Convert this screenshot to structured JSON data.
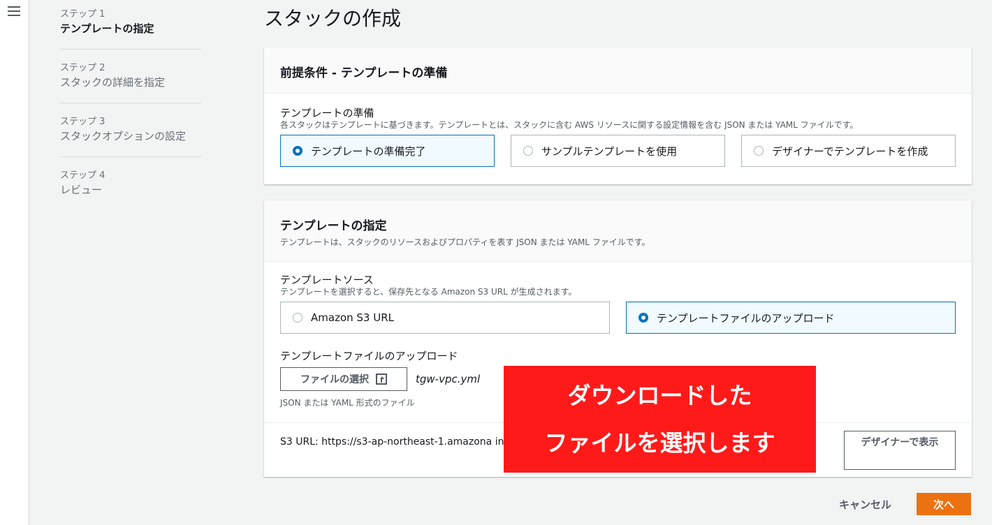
{
  "page": {
    "title": "スタックの作成"
  },
  "steps": [
    {
      "num": "ステップ 1",
      "title": "テンプレートの指定",
      "active": true
    },
    {
      "num": "ステップ 2",
      "title": "スタックの詳細を指定",
      "active": false
    },
    {
      "num": "ステップ 3",
      "title": "スタックオプションの設定",
      "active": false
    },
    {
      "num": "ステップ 4",
      "title": "レビュー",
      "active": false
    }
  ],
  "prereq": {
    "title": "前提条件 - テンプレートの準備",
    "field_label": "テンプレートの準備",
    "field_desc": "各スタックはテンプレートに基づきます。テンプレートとは、スタックに含む AWS リソースに関する設定情報を含む JSON または YAML ファイルです。",
    "options": [
      {
        "label": "テンプレートの準備完了",
        "selected": true
      },
      {
        "label": "サンプルテンプレートを使用",
        "selected": false
      },
      {
        "label": "デザイナーでテンプレートを作成",
        "selected": false
      }
    ]
  },
  "specify": {
    "title": "テンプレートの指定",
    "desc": "テンプレートは、スタックのリソースおよびプロパティを表す JSON または YAML ファイルです。",
    "source_label": "テンプレートソース",
    "source_desc": "テンプレートを選択すると、保存先となる Amazon S3 URL が生成されます。",
    "options": [
      {
        "label": "Amazon S3 URL",
        "selected": false
      },
      {
        "label": "テンプレートファイルのアップロード",
        "selected": true
      }
    ],
    "upload_label": "テンプレートファイルのアップロード",
    "file_button": "ファイルの選択",
    "file_name": "tgw-vpc.yml",
    "format_hint": "JSON または YAML 形式のファイル",
    "s3_url_text": "S3 URL:  https://s3-ap-northeast-1.amazona                                                                              inM-tgw-vpc.yml",
    "designer_button": "デザイナーで表示"
  },
  "callout": {
    "line1": "ダウンロードした",
    "line2": "ファイルを選択します"
  },
  "footer": {
    "cancel": "キャンセル",
    "next": "次へ"
  },
  "colors": {
    "accent": "#0073bb",
    "primary": "#ec7211",
    "callout": "#ff1a1a"
  }
}
